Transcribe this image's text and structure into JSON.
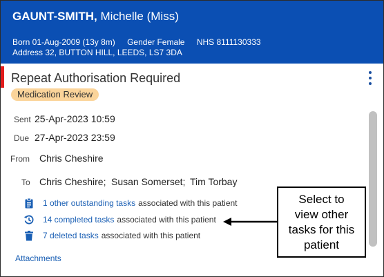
{
  "patient": {
    "surname": "GAUNT-SMITH,",
    "given_name": "Michelle (Miss)",
    "born": "Born 01-Aug-2009 (13y 8m)",
    "gender": "Gender Female",
    "nhs": "NHS 8111130333",
    "address": "Address 32, BUTTON HILL, LEEDS, LS7 3DA"
  },
  "banner_color": "#0b4fb3",
  "task": {
    "title": "Repeat Authorisation Required",
    "badge": "Medication Review",
    "sent_label": "Sent",
    "sent_value": "25-Apr-2023 10:59",
    "due_label": "Due",
    "due_value": "27-Apr-2023 23:59",
    "from_label": "From",
    "from_value": "Chris Cheshire",
    "to_label": "To",
    "to_recipients": [
      "Chris Cheshire;",
      "Susan Somerset;",
      "Tim Torbay"
    ]
  },
  "related_tasks": [
    {
      "icon": "clipboard-icon",
      "link": "1 other outstanding tasks",
      "suffix": "associated with this patient"
    },
    {
      "icon": "history-icon",
      "link": "14 completed tasks",
      "suffix": "associated with this patient"
    },
    {
      "icon": "trash-icon",
      "link": "7 deleted tasks",
      "suffix": "associated with this patient"
    }
  ],
  "attachments_label": "Attachments",
  "callout": {
    "lines": [
      "Select to",
      "view other",
      "tasks for this",
      "patient"
    ]
  },
  "colors": {
    "link": "#1a5fb4",
    "accent_red": "#e21c1c",
    "badge_bg": "#fbd49a"
  }
}
